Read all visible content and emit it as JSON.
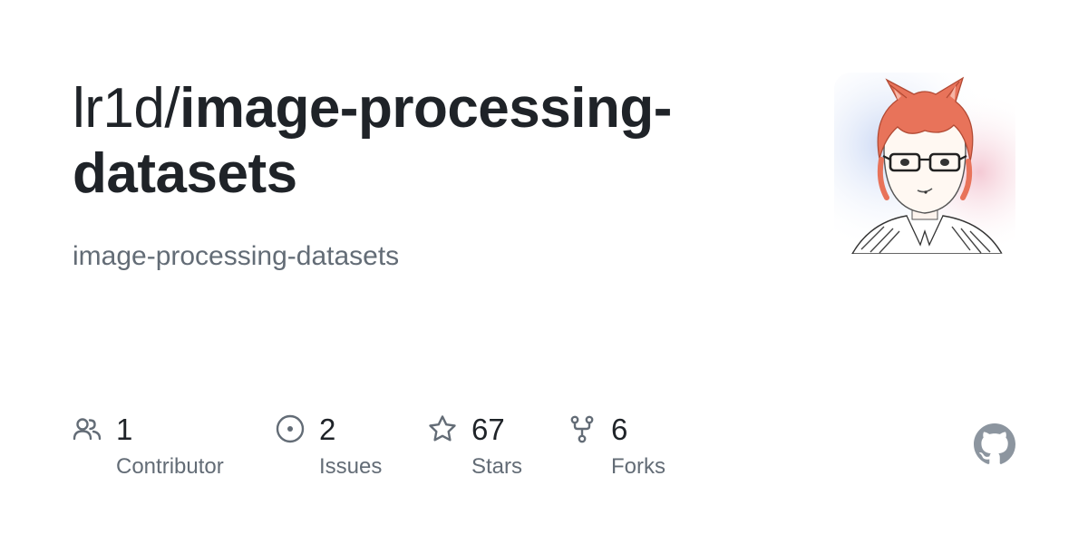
{
  "repo": {
    "owner": "lr1d/",
    "name": "image-processing-datasets",
    "description": "image-processing-datasets"
  },
  "avatar": {
    "alt": "owner avatar illustration"
  },
  "stats": [
    {
      "icon": "people-icon",
      "value": "1",
      "label": "Contributor"
    },
    {
      "icon": "issue-icon",
      "value": "2",
      "label": "Issues"
    },
    {
      "icon": "star-icon",
      "value": "67",
      "label": "Stars"
    },
    {
      "icon": "fork-icon",
      "value": "6",
      "label": "Forks"
    }
  ],
  "brand": {
    "icon": "github-logo-icon"
  },
  "colors": {
    "text_primary": "#1f2328",
    "text_muted": "#636c76",
    "icon_gray": "#636c76",
    "github_logo": "#8c959f",
    "hair": "#e8735a"
  }
}
